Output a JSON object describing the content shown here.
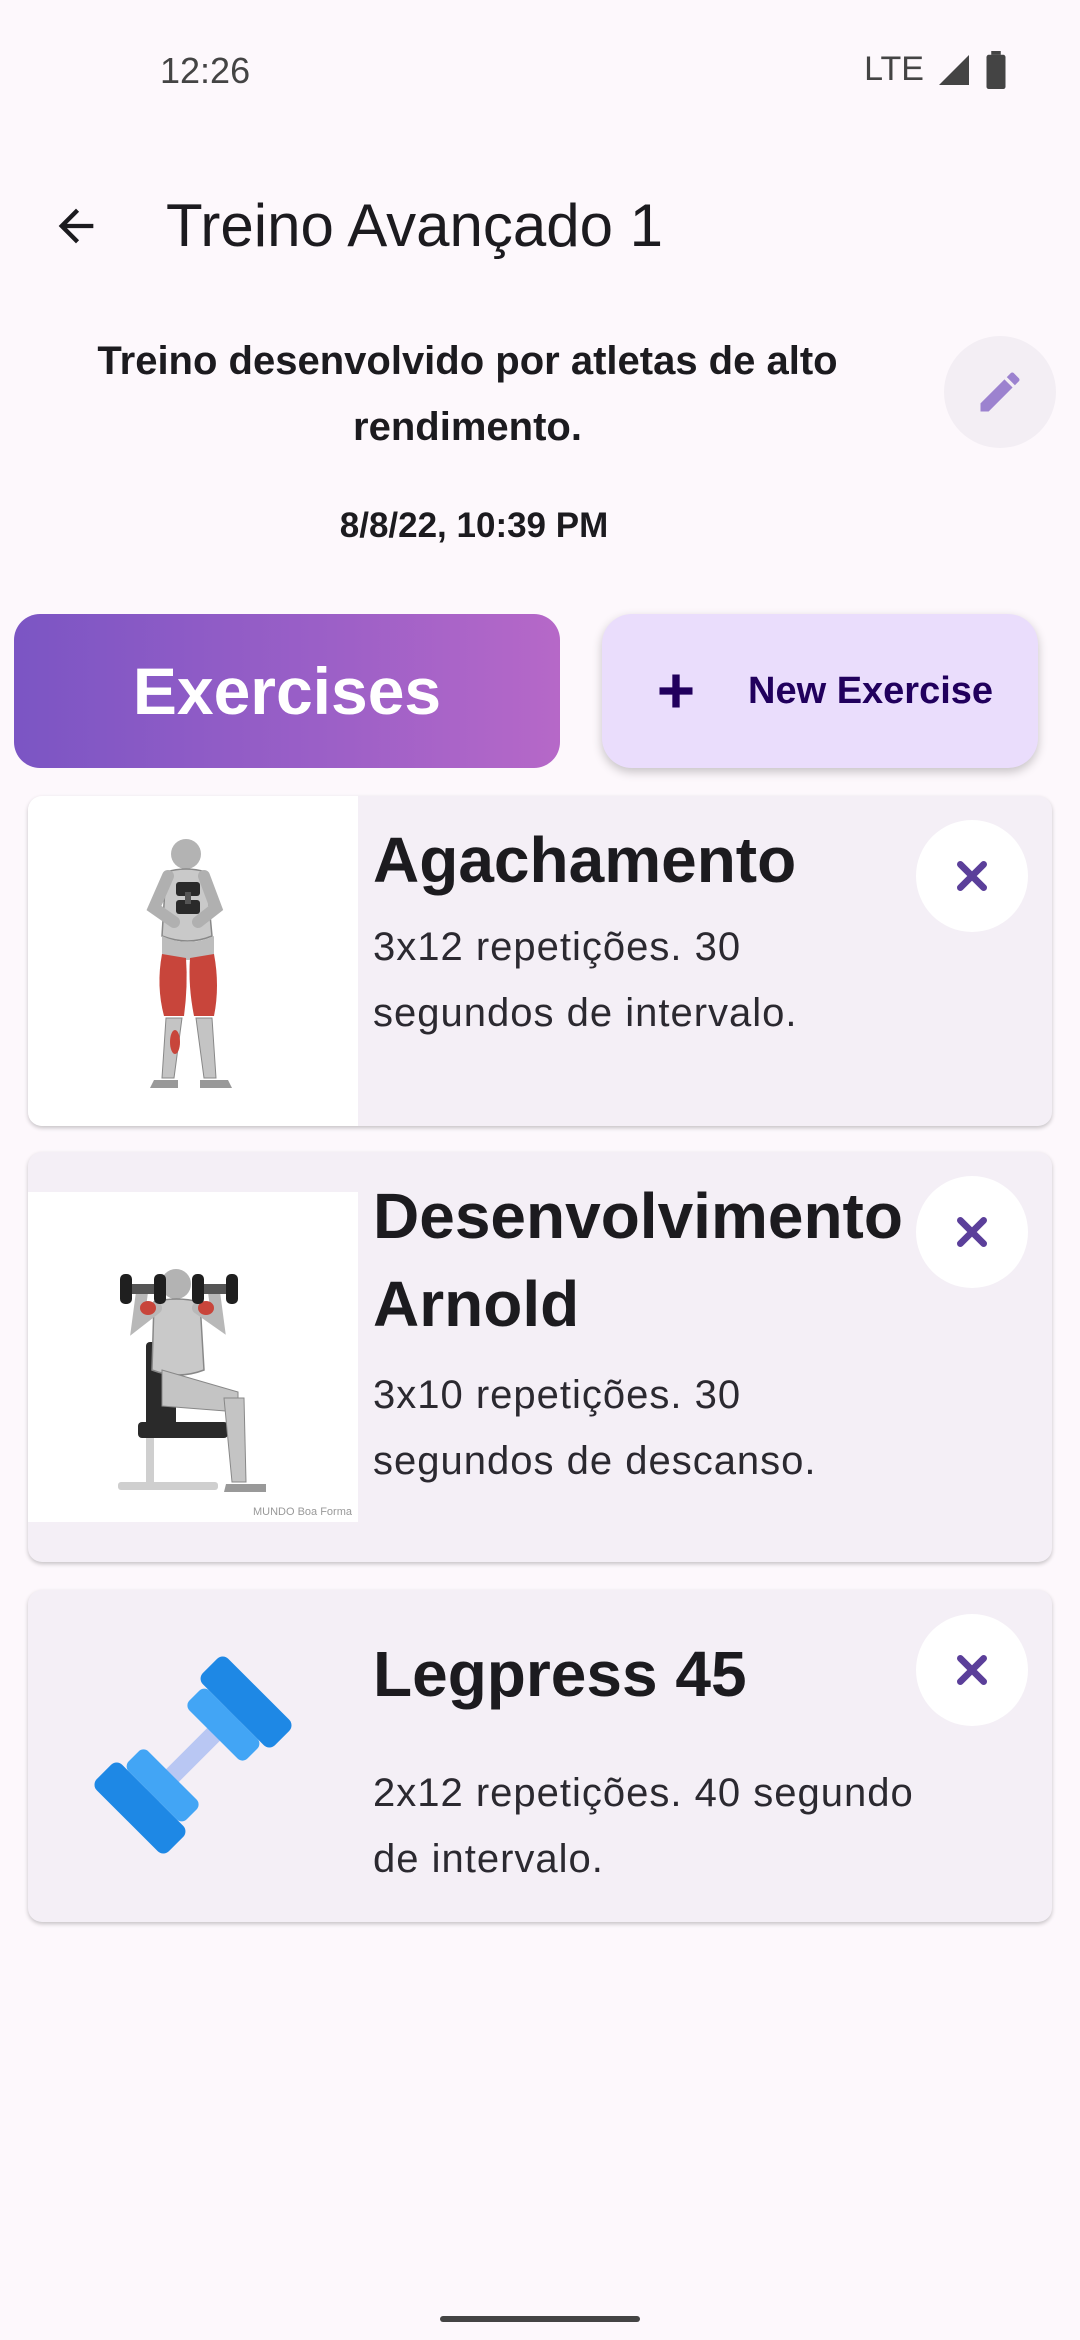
{
  "status_bar": {
    "time": "12:26",
    "network": "LTE"
  },
  "app_bar": {
    "title": "Treino Avançado 1"
  },
  "workout": {
    "description": "Treino desenvolvido por atletas de alto rendimento.",
    "date": "8/8/22, 10:39 PM"
  },
  "actions": {
    "exercises_label": "Exercises",
    "new_exercise_label": "New Exercise"
  },
  "exercises": [
    {
      "name": "Agachamento",
      "description": "3x12 repetições. 30 segundos de intervalo.",
      "image": "squat-illustration"
    },
    {
      "name": "Desenvolvimento Arnold",
      "description": "3x10 repetições. 30 segundos de descanso.",
      "image": "arnold-press-illustration",
      "watermark": "MUNDO Boa Forma"
    },
    {
      "name": "Legpress 45",
      "description": "2x12 repetições. 40 segundo de intervalo.",
      "image": "dumbbell-icon"
    }
  ],
  "colors": {
    "primary_gradient_start": "#7b55c4",
    "primary_gradient_end": "#b668c8",
    "accent": "#5b3f9a",
    "tonal_button": "#eaddfc",
    "card": "#f4eff6"
  },
  "icons": {
    "back": "arrow-left-icon",
    "edit": "pencil-icon",
    "add": "plus-icon",
    "delete": "close-icon"
  }
}
